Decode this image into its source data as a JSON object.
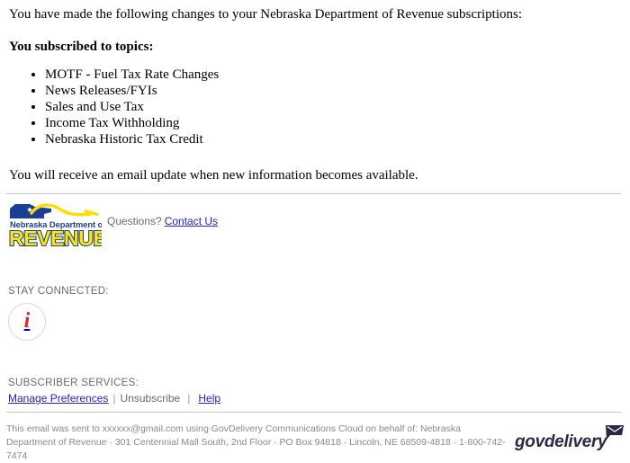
{
  "message": {
    "intro": "You have made the following changes to your Nebraska Department of Revenue subscriptions:",
    "subscribed_heading": "You subscribed to topics:",
    "topics": [
      "MOTF - Fuel Tax Rate Changes",
      "News Releases/FYIs",
      "Sales and Use Tax",
      "Income Tax Withholding",
      "Nebraska Historic Tax Credit"
    ],
    "closing": "You will receive an email update when new information becomes available."
  },
  "agency": {
    "logo": {
      "line1": "Nebraska Department of",
      "line2": "REVENUE",
      "shape_color": "#1b3f94",
      "swoosh_color": "#ffdd00",
      "wordmark_fill": "#ffe800",
      "wordmark_stroke": "#1b3f94"
    },
    "questions_label": "Questions?",
    "contact_link": "Contact Us"
  },
  "stay_connected": {
    "label": "STAY CONNECTED:",
    "icons": [
      {
        "name": "info-icon",
        "glyph": "i",
        "color": "#d8262c"
      }
    ]
  },
  "subscriber_services": {
    "label": "SUBSCRIBER SERVICES:",
    "links": [
      {
        "text": "Manage Preferences",
        "link": true
      },
      {
        "text": "Unsubscribe",
        "link": false
      },
      {
        "text": "Help",
        "link": true
      }
    ],
    "separator": "|"
  },
  "footer": {
    "line1": "This email was sent to xxxxxx@gmail.com using GovDelivery Communications Cloud on behalf of: Nebraska Department of",
    "line2": "Revenue · 301 Centennial Mall South, 2nd Floor · PO Box 94818 · Lincoln, NE 68509-4818 · 1-800-742-7474",
    "brand": "govdelivery",
    "brand_color": "#272a42"
  },
  "colors": {
    "link": "#2222cc",
    "muted_text": "#6b6b6b",
    "footer_text": "#8a8a8a",
    "rule": "#c6c6c6"
  }
}
